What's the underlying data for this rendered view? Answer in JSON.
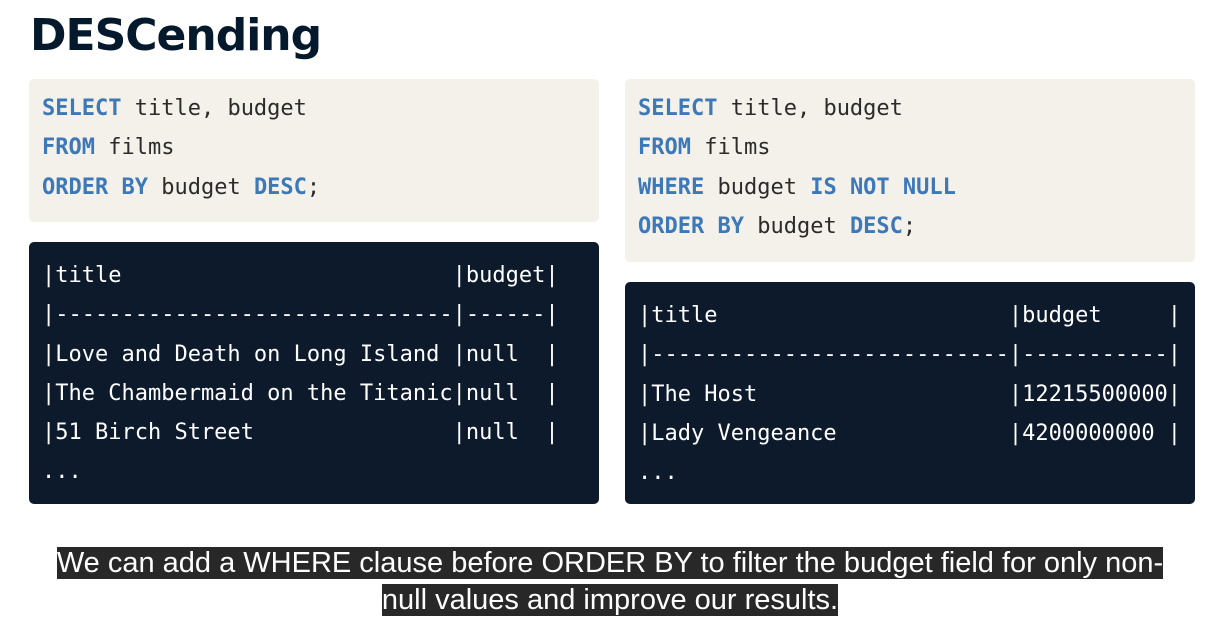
{
  "title": "DESCending",
  "left_query": {
    "l1_kw": "SELECT",
    "l1_rest": " title, budget",
    "l2_kw": "FROM",
    "l2_rest": " films",
    "l3_kw1": "ORDER BY",
    "l3_mid": " budget ",
    "l3_kw2": "DESC",
    "l3_end": ";"
  },
  "right_query": {
    "l1_kw": "SELECT",
    "l1_rest": " title, budget",
    "l2_kw": "FROM",
    "l2_rest": " films",
    "l3_kw1": "WHERE",
    "l3_mid": " budget ",
    "l3_kw2": "IS NOT NULL",
    "l4_kw1": "ORDER BY",
    "l4_mid": " budget ",
    "l4_kw2": "DESC",
    "l4_end": ";"
  },
  "left_result": [
    "|title                         |budget|",
    "|------------------------------|------|",
    "|Love and Death on Long Island |null  |",
    "|The Chambermaid on the Titanic|null  |",
    "|51 Birch Street               |null  |",
    "..."
  ],
  "right_result": [
    "|title                      |budget     |",
    "|---------------------------|-----------|",
    "|The Host                   |12215500000|",
    "|Lady Vengeance             |4200000000 |",
    "..."
  ],
  "caption": {
    "line1": "We can add a WHERE clause before ORDER BY to filter the budget field for only non-",
    "line2": "null values and improve our results."
  }
}
